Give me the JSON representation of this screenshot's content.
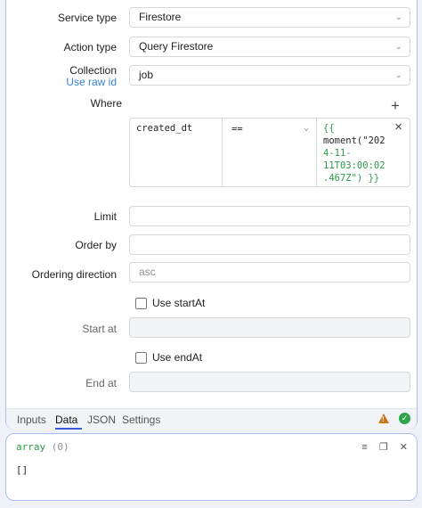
{
  "form": {
    "service_type": {
      "label": "Service type",
      "value": "Firestore"
    },
    "action_type": {
      "label": "Action type",
      "value": "Query Firestore"
    },
    "collection": {
      "label": "Collection",
      "link": "Use raw id",
      "value": "job"
    },
    "where": {
      "label": "Where",
      "add": "+",
      "field": "created_dt",
      "operator": "==",
      "value_lines": [
        "{{",
        "moment(\"202",
        "4-11-",
        "11T03:00:02",
        ".467Z\") }}"
      ],
      "remove": "×"
    },
    "limit": {
      "label": "Limit",
      "value": ""
    },
    "order_by": {
      "label": "Order by",
      "value": ""
    },
    "ordering_direction": {
      "label": "Ordering direction",
      "placeholder": "asc"
    },
    "use_start_at": {
      "label": "Use startAt",
      "checked": false
    },
    "start_at": {
      "label": "Start at",
      "value": ""
    },
    "use_end_at": {
      "label": "Use endAt",
      "checked": false
    },
    "end_at": {
      "label": "End at",
      "value": ""
    }
  },
  "tabs": [
    {
      "label": "Inputs"
    },
    {
      "label": "Data",
      "active": true
    },
    {
      "label": "JSON"
    },
    {
      "label": "Settings"
    }
  ],
  "status": {
    "warning_icon": "warning-icon",
    "ok_icon": "check-icon",
    "warning_color": "#c9761b",
    "ok_color": "#2ea44f"
  },
  "result": {
    "type": "array",
    "count": "(0)",
    "value": "[]"
  },
  "colors": {
    "accent": "#3b5bdb",
    "link": "#3b82d6",
    "code": "#2e9a4a"
  }
}
